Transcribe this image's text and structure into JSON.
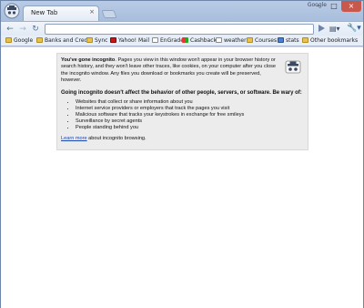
{
  "titlebar": {
    "tab_title": "New Tab",
    "tab_close": "×",
    "google_label": "Google",
    "minimize": "–",
    "maximize": "□",
    "close": "×"
  },
  "toolbar": {
    "back": "←",
    "forward": "→",
    "reload": "↻",
    "address_value": "",
    "go": "▶",
    "page_menu": "▤▾",
    "wrench_menu": "🔧▾"
  },
  "bookmarks": [
    {
      "label": "Google",
      "icon": "folder-icon"
    },
    {
      "label": "Banks and Credit",
      "icon": "folder-icon"
    },
    {
      "label": "Sync",
      "icon": "folder-icon"
    },
    {
      "label": "Yahoo! Mail",
      "icon": "yahoo-icon"
    },
    {
      "label": "EnGrade",
      "icon": "doc-icon"
    },
    {
      "label": "Cashback",
      "icon": "cashback-icon"
    },
    {
      "label": "weather",
      "icon": "doc-icon"
    },
    {
      "label": "Courses",
      "icon": "folder-icon"
    },
    {
      "label": "stats",
      "icon": "stats-icon"
    },
    {
      "label": "Other bookmarks",
      "icon": "folder-icon"
    }
  ],
  "incognito": {
    "intro_bold": "You've gone incognito",
    "intro_rest": ". Pages you view in this window won't appear in your browser history or search history, and they won't leave other traces, like cookies, on your computer after you close the incognito window. Any files you download or bookmarks you create will be preserved, however.",
    "heading": "Going incognito doesn't affect the behavior of other people, servers, or software. Be wary of:",
    "bullets": [
      "Websites that collect or share information about you",
      "Internet service providers or employers that track the pages you visit",
      "Malicious software that tracks your keystrokes in exchange for free smileys",
      "Surveillance by secret agents",
      "People standing behind you"
    ],
    "learn_more": "Learn more",
    "learn_more_rest": " about incognito browsing."
  },
  "colors": {
    "frame": "#b9cbe5",
    "panel_bg": "#ececec",
    "link": "#1b46b5"
  }
}
